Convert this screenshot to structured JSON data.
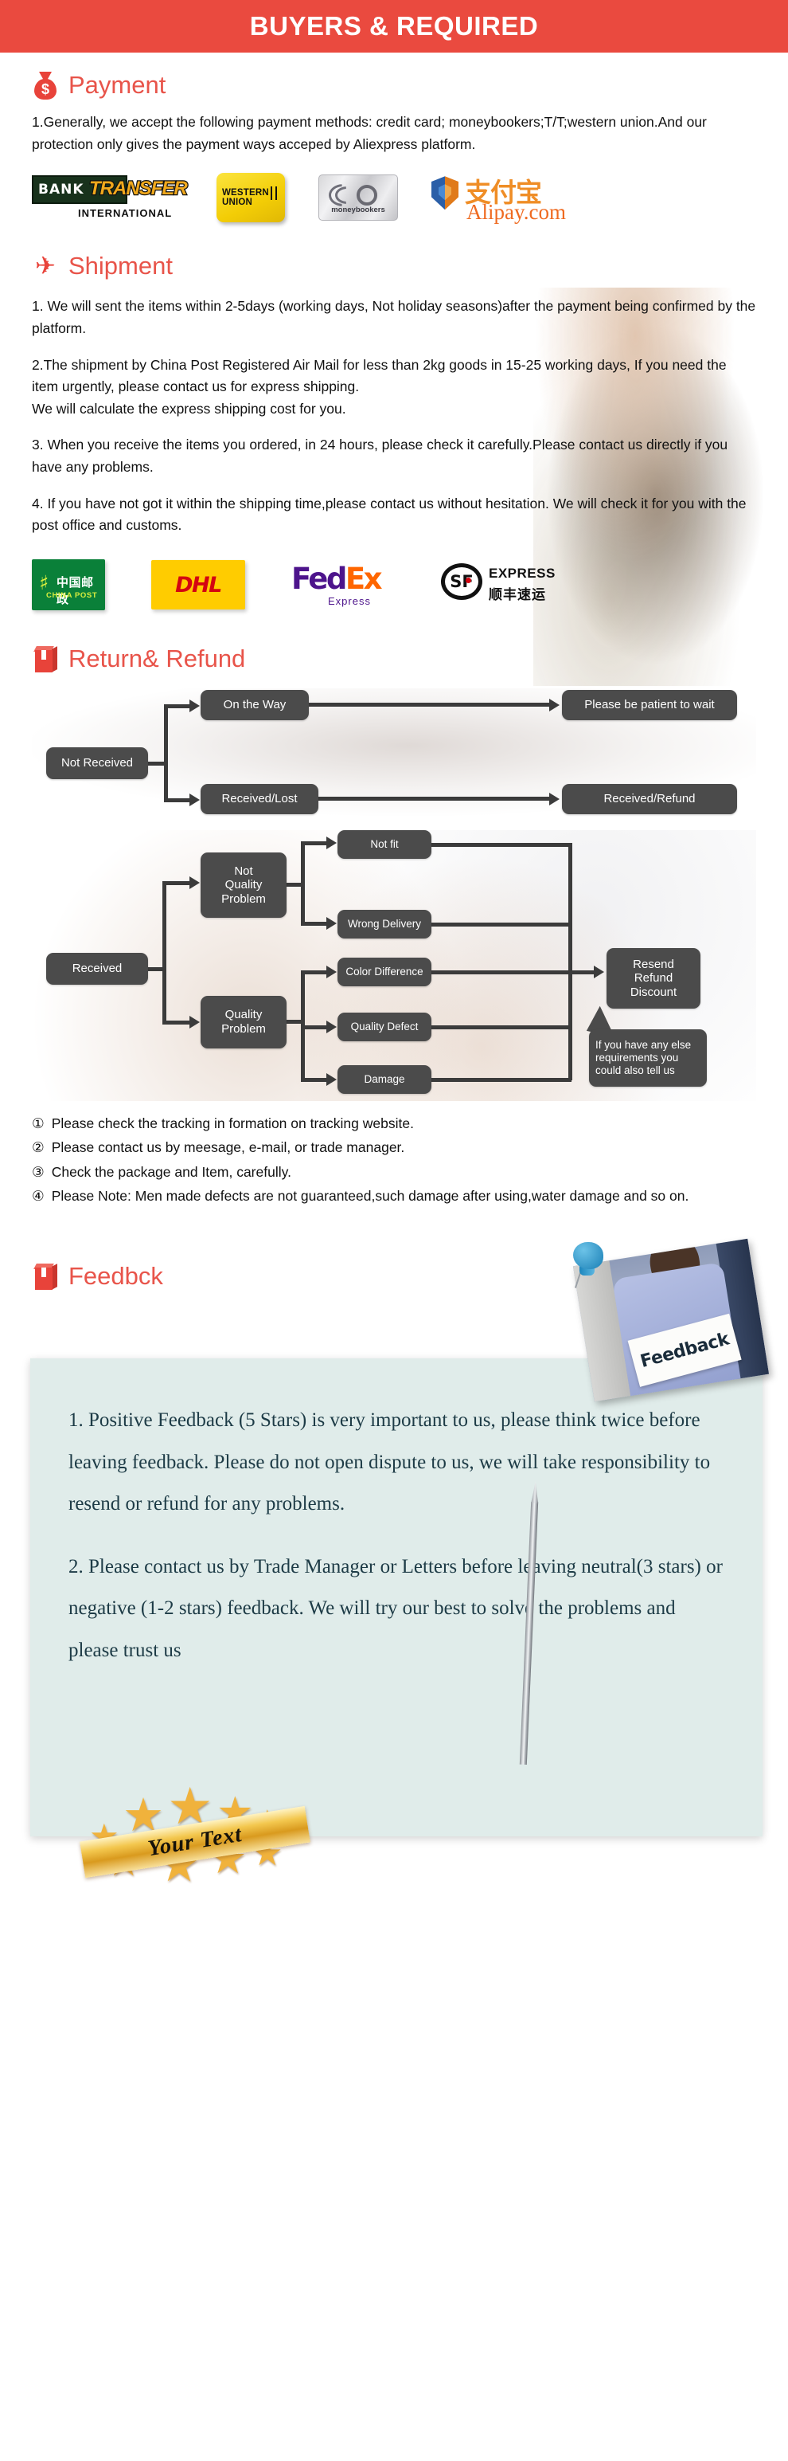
{
  "banner": {
    "title": "BUYERS & REQUIRED"
  },
  "payment": {
    "heading": "Payment",
    "icon": "money-bag-icon",
    "paragraph": "1.Generally, we accept the following payment methods: credit card; moneybookers;T/T;western union.And our protection only gives the payment ways acceped by Aliexpress platform.",
    "logos": [
      {
        "name": "bank-transfer-logo",
        "line1": "BANK",
        "line2": "TRANSFER",
        "line3": "INTERNATIONAL"
      },
      {
        "name": "western-union-logo",
        "line1": "WESTERN",
        "line2": "UNION"
      },
      {
        "name": "moneybookers-logo",
        "label": "moneybookers"
      },
      {
        "name": "alipay-logo",
        "cn": "支付宝",
        "en": "Alipay.com"
      }
    ]
  },
  "shipment": {
    "heading": "Shipment",
    "icon": "airplane-icon",
    "paragraphs": [
      "1. We will sent the items within 2-5days (working days, Not holiday seasons)after the payment being confirmed by the platform.",
      "2.The shipment by China Post Registered Air Mail for less than  2kg goods in 15-25 working days, If  you need the item urgently, please contact us for express shipping.\nWe will calculate the express shipping cost for you.",
      "3. When you receive the items you ordered, in 24 hours, please check it carefully.Please contact us directly if you have any problems.",
      "4. If you have not got it within the shipping time,please contact us without hesitation. We will check it for you with the post office and customs."
    ],
    "logos": [
      {
        "name": "china-post-logo",
        "cn": "中国邮政",
        "en": "CHINA POST"
      },
      {
        "name": "dhl-logo",
        "label": "DHL"
      },
      {
        "name": "fedex-logo",
        "part1": "Fed",
        "part2": "Ex",
        "sub": "Express"
      },
      {
        "name": "sf-express-logo",
        "mark": "SF",
        "en": "EXPRESS",
        "cn": "顺丰速运"
      }
    ]
  },
  "returns": {
    "heading": "Return& Refund",
    "icon": "package-icon",
    "flow_top": {
      "root": "Not Received",
      "branch_a": "On the Way",
      "branch_a_result": "Please be patient to wait",
      "branch_b": "Received/Lost",
      "branch_b_result": "Received/Refund"
    },
    "flow_bottom": {
      "root": "Received",
      "group_a": "Not\nQuality\nProblem",
      "group_a_items": [
        "Not fit",
        "Wrong Delivery"
      ],
      "group_b": "Quality\nProblem",
      "group_b_items": [
        "Color Difference",
        "Quality Defect",
        "Damage"
      ],
      "result": "Resend\nRefund\nDiscount",
      "callout": "If you have any else requirements you could also tell us"
    },
    "notes": [
      {
        "num": "①",
        "text": "Please check the tracking in formation on tracking website."
      },
      {
        "num": "②",
        "text": "Please contact us by meesage, e-mail, or trade manager."
      },
      {
        "num": "③",
        "text": "Check the package and Item, carefully."
      },
      {
        "num": "④",
        "text": "Please Note: Men made defects  are not guaranteed,such damage after using,water damage and so on."
      }
    ]
  },
  "feedback": {
    "heading": "Feedbck",
    "icon": "package-icon",
    "photo_sign_text": "Feedback",
    "paragraphs": [
      "1. Positive Feedback (5 Stars) is very important to us, please think twice before leaving feedback. Please do not open dispute to us,   we will take responsibility to resend or refund for any problems.",
      "2. Please contact us by Trade Manager or Letters before leaving neutral(3 stars) or negative (1-2 stars) feedback. We will try our best to solve the problems and please trust us"
    ],
    "badge_text": "Your Text"
  },
  "colors": {
    "banner_bg": "#ea4a3f",
    "heading_red": "#e8544a",
    "node_gray": "#4b4b4b",
    "feedback_panel": "#e0ecea"
  }
}
